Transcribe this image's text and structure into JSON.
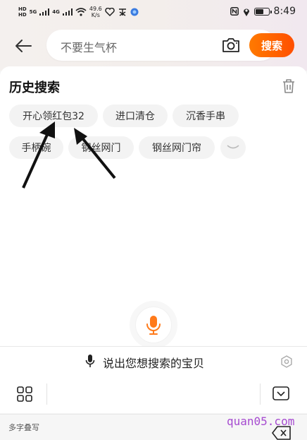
{
  "status_bar": {
    "hd1": "HD",
    "hd2": "HD",
    "net1": "5G",
    "net2": "4G",
    "speed_value": "49.6",
    "speed_unit": "K/s",
    "time": "8:49"
  },
  "search": {
    "placeholder": "不要生气杯",
    "button_label": "搜索"
  },
  "history": {
    "title": "历史搜索",
    "items": [
      "开心领红包32",
      "进口清仓",
      "沉香手串",
      "手柄碗",
      "钢丝网门",
      "钢丝网门帘"
    ]
  },
  "voice": {
    "prompt": "说出您想搜索的宝贝"
  },
  "keyboard": {
    "mode_label": "多字叠写"
  },
  "watermark": "quan05.com",
  "colors": {
    "accent": "#ff5a00",
    "chip_bg": "#f3f3f3"
  }
}
